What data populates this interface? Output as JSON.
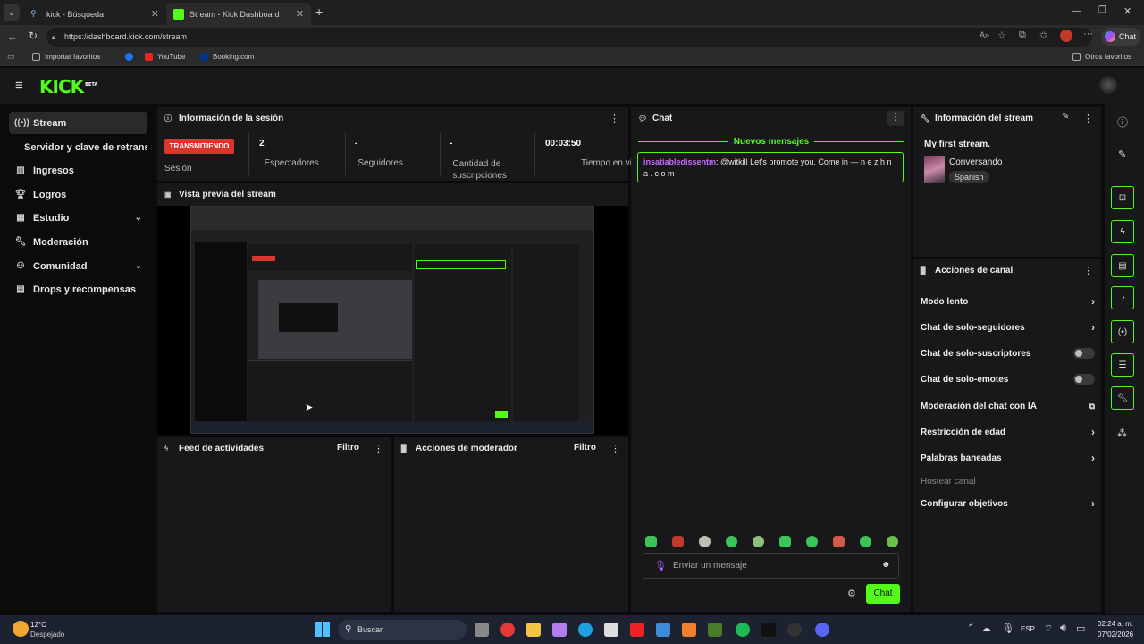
{
  "browser": {
    "tabs": [
      {
        "title": "kick - Búsqueda",
        "active": false
      },
      {
        "title": "Stream - Kick Dashboard",
        "active": true
      }
    ],
    "url": "https://dashboard.kick.com/stream",
    "chat_button": "Chat",
    "bookmarks": [
      "Importar favoritos",
      "YouTube",
      "Booking.com"
    ],
    "other_bookmarks": "Otros favoritos"
  },
  "app": {
    "logo": "KICK",
    "logo_badge": "BETA",
    "accent": "#53fc18"
  },
  "sidebar": {
    "items": [
      {
        "label": "Stream",
        "icon": "broadcast-icon",
        "active": true
      },
      {
        "label": "Servidor y clave de retransm",
        "icon": ""
      },
      {
        "label": "Ingresos",
        "icon": "chart-icon"
      },
      {
        "label": "Logros",
        "icon": "trophy-icon"
      },
      {
        "label": "Estudio",
        "icon": "grid-icon",
        "expandable": true
      },
      {
        "label": "Moderación",
        "icon": "wrench-icon"
      },
      {
        "label": "Comunidad",
        "icon": "community-icon",
        "expandable": true
      },
      {
        "label": "Drops y recompensas",
        "icon": "gift-icon"
      }
    ]
  },
  "session": {
    "title": "Información de la sesión",
    "status_badge": "TRANSMITIENDO",
    "status_label": "Sesión",
    "stats": [
      {
        "value": "2",
        "label": "Espectadores"
      },
      {
        "value": "-",
        "label": "Seguidores"
      },
      {
        "value": "-",
        "label": "Cantidad de suscripciones"
      },
      {
        "value": "00:03:50",
        "label": "Tiempo en vivo"
      }
    ]
  },
  "preview": {
    "title": "Vista previa del stream"
  },
  "activity": {
    "title": "Feed de actividades",
    "filter": "Filtro"
  },
  "moderator": {
    "title": "Acciones de moderador",
    "filter": "Filtro"
  },
  "chat": {
    "title": "Chat",
    "new_messages": "Nuevos mensajes",
    "messages": [
      {
        "user": "insatiabledissentm",
        "text": ": @witkill Let's promote you. Come in — n e z h n a . c o m"
      }
    ],
    "input_placeholder": "Enviar un mensaje",
    "send_button": "Chat"
  },
  "stream_info": {
    "title": "Información del stream",
    "stream_title": "My first stream.",
    "category": "Conversando",
    "language": "Spanish"
  },
  "channel_actions": {
    "title": "Acciones de canal",
    "items": [
      {
        "label": "Modo lento",
        "control": "arrow"
      },
      {
        "label": "Chat de solo-seguidores",
        "control": "arrow"
      },
      {
        "label": "Chat de solo-suscriptores",
        "control": "toggle"
      },
      {
        "label": "Chat de solo-emotes",
        "control": "toggle"
      },
      {
        "label": "Moderación del chat con IA",
        "control": "external"
      },
      {
        "label": "Restricción de edad",
        "control": "arrow"
      },
      {
        "label": "Palabras baneadas",
        "control": "arrow"
      },
      {
        "label": "Hostear canal",
        "control": "none",
        "disabled": true
      },
      {
        "label": "Configurar objetivos",
        "control": "arrow"
      }
    ]
  },
  "taskbar": {
    "weather_temp": "12°C",
    "weather_desc": "Despejado",
    "search": "Buscar",
    "lang": "ESP",
    "time": "02:24 a. m.",
    "date": "07/02/2026"
  }
}
